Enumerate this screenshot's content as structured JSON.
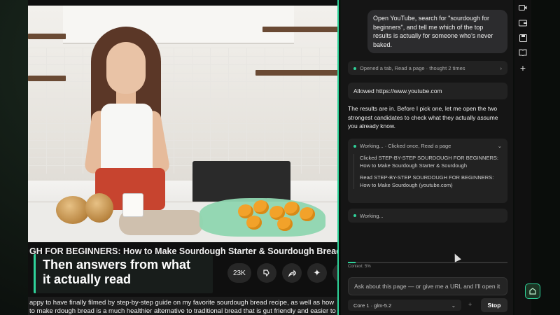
{
  "video": {
    "title": "GH FOR BEGINNERS: How to Make Sourdough Starter & Sourdough Bread",
    "like_count": "23K",
    "description": "appy to have finally filmed by step-by-step guide on my favorite sourdough bread recipe, as well as how to make rdough bread is a much healthier alternative to traditional bread that is gut friendly and easier to digest with it's"
  },
  "caption": {
    "line1": "Then answers from what",
    "line2": "it actually read"
  },
  "assistant": {
    "user_message": "Open YouTube, search for \"sourdough for beginners\", and tell me which of the top results is actually for someone who's never baked.",
    "steps_summary": "Opened a tab, Read a page · thought 2 times",
    "allowed_text": "Allowed https://www.youtube.com",
    "response": "The results are in. Before I pick one, let me open the two strongest candidates to check what they actually assume you already know.",
    "working_header": "Working... · Clicked once, Read a page",
    "working_items": [
      "Clicked STEP-BY-STEP SOURDOUGH FOR BEGINNERS: How to Make Sourdough Starter & Sourdough",
      "Read STEP-BY-STEP SOURDOUGH FOR BEGINNERS: How to Make Sourdough (youtube.com)"
    ],
    "working_status": "Working...",
    "context_label": "Context: 5%",
    "context_fraction": 0.05,
    "input_placeholder": "Ask about this page — or give me a URL and I'll open it",
    "model_label": "Core 1 · glm-5.2",
    "stop_label": "Stop"
  },
  "rail_icons": [
    "video-icon",
    "wallet-icon",
    "save-icon",
    "book-icon",
    "plus-icon"
  ],
  "colors": {
    "accent": "#2fd39a",
    "panel_bg": "#151515",
    "bubble_bg": "#2c2c2e"
  }
}
